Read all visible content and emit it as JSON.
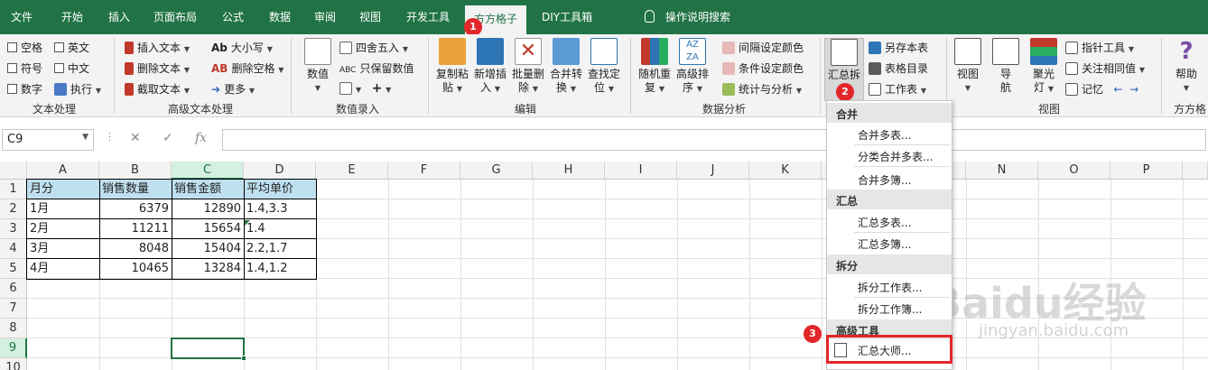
{
  "tabs": [
    {
      "label": "文件"
    },
    {
      "label": "开始"
    },
    {
      "label": "插入"
    },
    {
      "label": "页面布局"
    },
    {
      "label": "公式"
    },
    {
      "label": "数据"
    },
    {
      "label": "审阅"
    },
    {
      "label": "视图"
    },
    {
      "label": "开发工具"
    },
    {
      "label": "方方格子"
    },
    {
      "label": "DIY工具箱"
    }
  ],
  "tell_me": "操作说明搜索",
  "badges": [
    "1",
    "2",
    "3"
  ],
  "ribbon": {
    "text_processing": {
      "label": "文本处理",
      "items": [
        "空格",
        "英文",
        "符号",
        "中文",
        "数字",
        "执行"
      ]
    },
    "advanced_text": {
      "label": "高级文本处理",
      "items": [
        "插入文本",
        "删除文本",
        "截取文本",
        "大小写",
        "删除空格",
        "更多"
      ]
    },
    "number_entry": {
      "label": "数值录入",
      "big": "数值",
      "items": [
        "四舍五入",
        "只保留数值",
        "+"
      ]
    },
    "edit": {
      "label": "编辑",
      "buttons": [
        {
          "l1": "复制粘",
          "l2": "贴"
        },
        {
          "l1": "新增插",
          "l2": "入"
        },
        {
          "l1": "批量删",
          "l2": "除"
        },
        {
          "l1": "合并转",
          "l2": "换"
        },
        {
          "l1": "查找定",
          "l2": "位"
        }
      ]
    },
    "data_analysis": {
      "label": "数据分析",
      "buttons": [
        {
          "l1": "随机重",
          "l2": "复"
        },
        {
          "l1": "高级排",
          "l2": "序"
        }
      ],
      "items": [
        "间隔设定颜色",
        "条件设定颜色",
        "统计与分析"
      ]
    },
    "summary": {
      "big": "汇总拆",
      "items": [
        "另存本表",
        "表格目录",
        "工作表"
      ]
    },
    "view": {
      "label": "视图",
      "buttons": [
        {
          "l1": "视图",
          "l2": ""
        },
        {
          "l1": "导",
          "l2": "航"
        },
        {
          "l1": "聚光",
          "l2": "灯"
        }
      ],
      "items": [
        "指针工具",
        "关注相同值",
        "记忆"
      ]
    },
    "help": {
      "big": "帮助",
      "label": "方方格"
    }
  },
  "name_box": "C9",
  "formula_icons": {
    "cancel": "✕",
    "enter": "✓",
    "fx": "fx"
  },
  "columns": [
    "A",
    "B",
    "C",
    "D",
    "E",
    "F",
    "G",
    "H",
    "I",
    "J",
    "K",
    "L",
    "M",
    "N",
    "O",
    "P"
  ],
  "rows": [
    "1",
    "2",
    "3",
    "4",
    "5",
    "6",
    "7",
    "8",
    "9",
    "10"
  ],
  "table": {
    "headers": [
      "月分",
      "销售数量",
      "销售金额",
      "平均单价"
    ],
    "rows": [
      [
        "1月",
        "6379",
        "12890",
        "1.4,3.3"
      ],
      [
        "2月",
        "11211",
        "15654",
        "1.4"
      ],
      [
        "3月",
        "8048",
        "15404",
        "2.2,1.7"
      ],
      [
        "4月",
        "10465",
        "13284",
        "1.4,1.2"
      ]
    ]
  },
  "menu": {
    "sections": [
      {
        "title": "合并",
        "items": [
          "合并多表...",
          "分类合并多表...",
          "合并多簿..."
        ]
      },
      {
        "title": "汇总",
        "items": [
          "汇总多表...",
          "汇总多簿..."
        ]
      },
      {
        "title": "拆分",
        "items": [
          "拆分工作表...",
          "拆分工作簿..."
        ]
      },
      {
        "title": "高级工具",
        "items": [
          "汇总大师..."
        ]
      }
    ]
  },
  "watermark": {
    "main": "Baidu经验",
    "sub": "jingyan.baidu.com"
  },
  "colors": {
    "excel_green": "#217346",
    "badge_red": "#e3262a",
    "header_fill": "#bfe0ef"
  }
}
